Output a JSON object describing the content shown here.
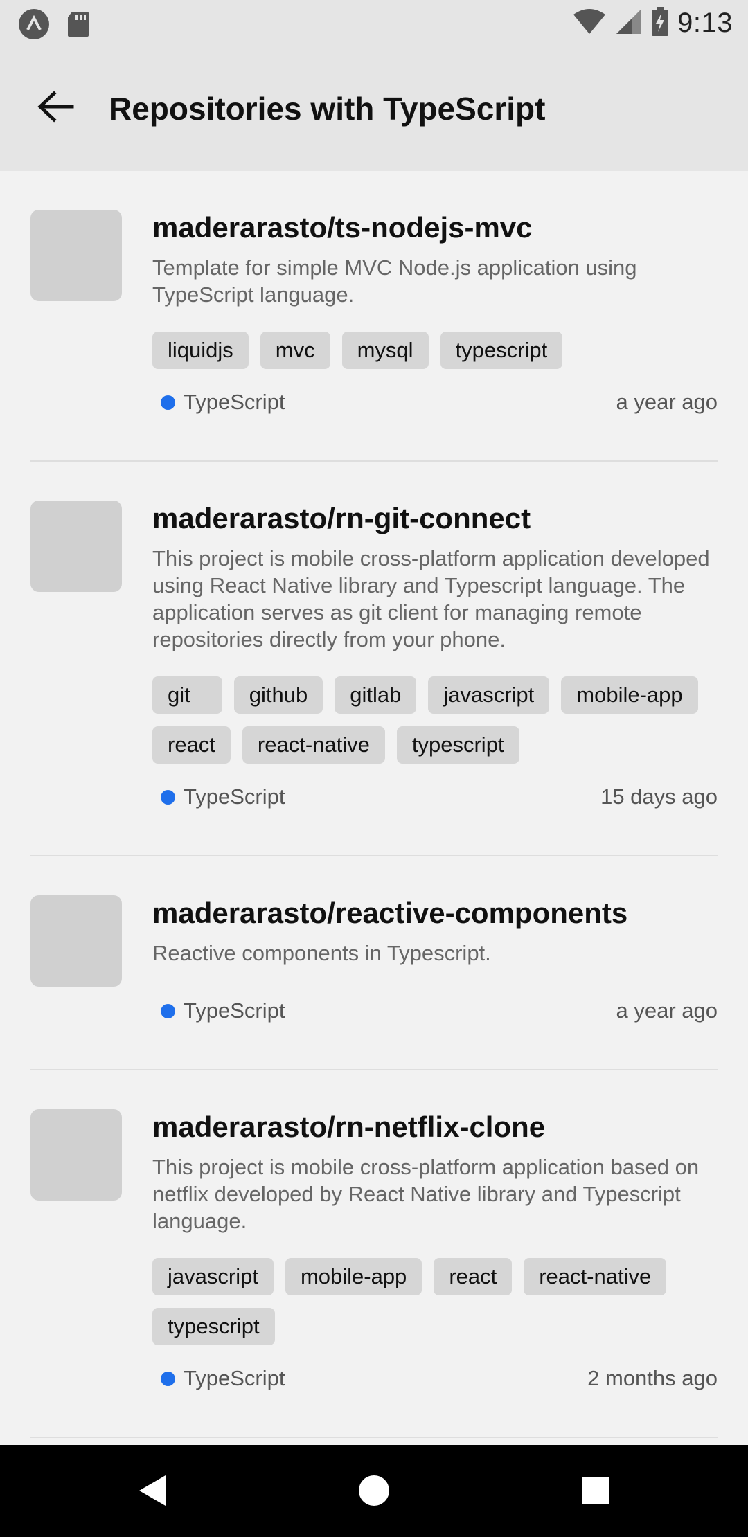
{
  "status_bar": {
    "time": "9:13",
    "icons": [
      "app-icon",
      "sd-card-icon",
      "wifi-icon",
      "signal-icon",
      "battery-charging-icon"
    ]
  },
  "app_bar": {
    "title": "Repositories with TypeScript",
    "back_icon": "arrow-left-icon"
  },
  "repos": [
    {
      "name": "maderarasto/ts-nodejs-mvc",
      "description": "Template for simple MVC Node.js application using TypeScript language.",
      "tags": [
        "liquidjs",
        "mvc",
        "mysql",
        "typescript"
      ],
      "language": "TypeScript",
      "updated": "a year ago"
    },
    {
      "name": "maderarasto/rn-git-connect",
      "description": "This project is mobile cross-platform application developed using React Native library and Typescript language. The application serves as git client for managing remote repositories directly from your phone.",
      "tags": [
        "git",
        "github",
        "gitlab",
        "javascript",
        "mobile-app",
        "react",
        "react-native",
        "typescript"
      ],
      "language": "TypeScript",
      "updated": "15 days ago"
    },
    {
      "name": "maderarasto/reactive-components",
      "description": "Reactive components in Typescript.",
      "tags": [],
      "language": "TypeScript",
      "updated": "a year ago"
    },
    {
      "name": "maderarasto/rn-netflix-clone",
      "description": "This project is mobile cross-platform application based on netflix developed by React Native library and Typescript language.",
      "tags": [
        "javascript",
        "mobile-app",
        "react",
        "react-native",
        "typescript"
      ],
      "language": "TypeScript",
      "updated": "2 months ago"
    }
  ],
  "language_color": "#1f6feb",
  "nav_bar": {
    "icons": [
      "nav-back-icon",
      "nav-home-icon",
      "nav-recents-icon"
    ]
  }
}
